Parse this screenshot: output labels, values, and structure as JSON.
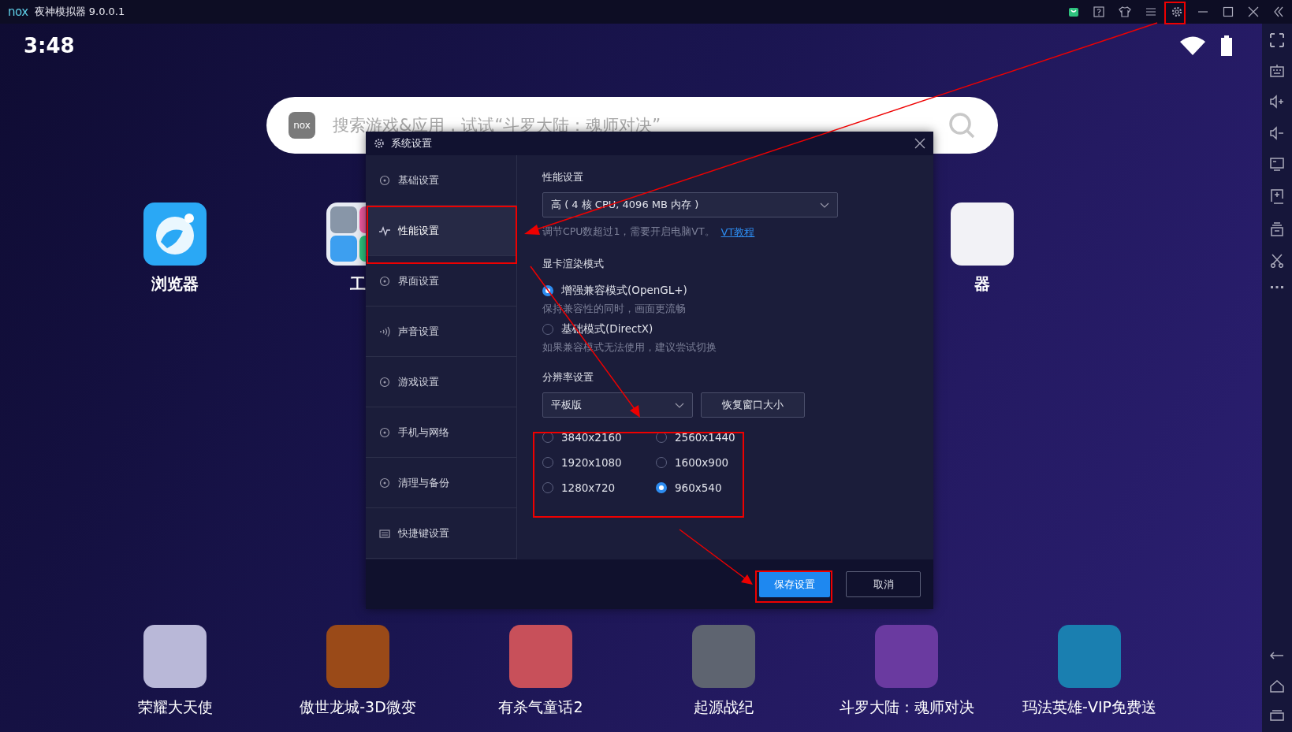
{
  "title_bar": {
    "logo": "nox",
    "title": "夜神模拟器 9.0.0.1"
  },
  "status_bar": {
    "time": "3:48"
  },
  "search": {
    "logo": "nox",
    "placeholder": "搜索游戏&应用，试试“斗罗大陆：魂师对决”"
  },
  "desktop_apps": [
    {
      "label": "浏览器",
      "kind": "browser"
    },
    {
      "label": "工",
      "kind": "folder"
    },
    {
      "label": "器",
      "kind": "hidden"
    }
  ],
  "dialog": {
    "title": "系统设置",
    "nav_items": [
      {
        "label": "基础设置",
        "selected": false
      },
      {
        "label": "性能设置",
        "selected": true
      },
      {
        "label": "界面设置",
        "selected": false
      },
      {
        "label": "声音设置",
        "selected": false
      },
      {
        "label": "游戏设置",
        "selected": false
      },
      {
        "label": "手机与网络",
        "selected": false
      },
      {
        "label": "清理与备份",
        "selected": false
      },
      {
        "label": "快捷键设置",
        "selected": false
      }
    ],
    "performance": {
      "heading": "性能设置",
      "value": "高 ( 4 核 CPU, 4096 MB 内存 )",
      "hint": "调节CPU数超过1，需要开启电脑VT。",
      "link": "VT教程"
    },
    "render_mode": {
      "heading": "显卡渲染模式",
      "options": [
        {
          "label": "增强兼容模式(OpenGL+)",
          "description": "保持兼容性的同时，画面更流畅",
          "selected": true
        },
        {
          "label": "基础模式(DirectX)",
          "description": "如果兼容模式无法使用，建议尝试切换",
          "selected": false
        }
      ]
    },
    "resolution": {
      "heading": "分辨率设置",
      "value": "平板版",
      "reset_button": "恢复窗口大小",
      "options": [
        {
          "label": "3840x2160",
          "selected": false
        },
        {
          "label": "2560x1440",
          "selected": false
        },
        {
          "label": "1920x1080",
          "selected": false
        },
        {
          "label": "1600x900",
          "selected": false
        },
        {
          "label": "1280x720",
          "selected": false
        },
        {
          "label": "960x540",
          "selected": true
        }
      ]
    },
    "buttons": [
      {
        "label": "保存设置",
        "kind": "primary"
      },
      {
        "label": "取消",
        "kind": "secondary"
      }
    ]
  },
  "dock_apps": [
    {
      "label": "荣耀大天使",
      "color": "#b9b8d8"
    },
    {
      "label": "傲世龙城-3D微变",
      "color": "#9a4a18"
    },
    {
      "label": "有杀气童话2",
      "color": "#c8505a"
    },
    {
      "label": "起源战纪",
      "color": "#5e6470"
    },
    {
      "label": "斗罗大陆：魂师对决",
      "color": "#6a3aa0"
    },
    {
      "label": "玛法英雄-VIP免费送",
      "color": "#1a7fb0"
    }
  ]
}
